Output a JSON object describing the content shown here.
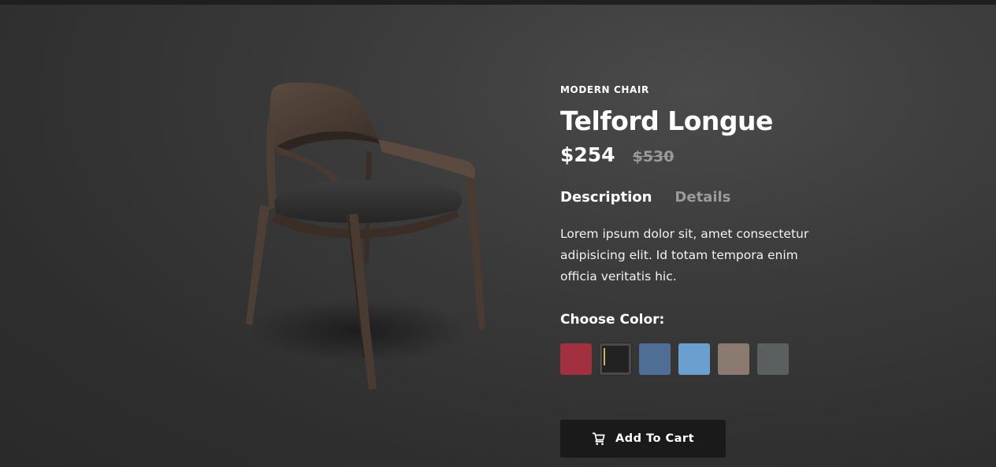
{
  "product": {
    "category": "MODERN CHAIR",
    "name": "Telford Longue",
    "price": "$254",
    "old_price": "$530",
    "image_icon": "chair-image"
  },
  "tabs": [
    {
      "label": "Description",
      "active": true
    },
    {
      "label": "Details",
      "active": false
    }
  ],
  "description": "Lorem ipsum dolor sit, amet consectetur adipisicing elit. Id totam tempora enim officia veritatis hic.",
  "color_picker": {
    "label": "Choose Color:",
    "selected_index": 1,
    "swatches": [
      {
        "name": "red",
        "color": "#a3303e"
      },
      {
        "name": "black",
        "color": "#222222"
      },
      {
        "name": "denim-blue",
        "color": "#4f6e96"
      },
      {
        "name": "light-blue",
        "color": "#6a9fcf"
      },
      {
        "name": "taupe",
        "color": "#8a7a70"
      },
      {
        "name": "gray",
        "color": "#5c5f60"
      }
    ]
  },
  "cart_button": {
    "label": "Add To Cart",
    "icon": "cart-icon"
  },
  "colors": {
    "background": "#333333",
    "button_bg": "#1a1a1a",
    "muted_text": "#9b9b9b"
  }
}
